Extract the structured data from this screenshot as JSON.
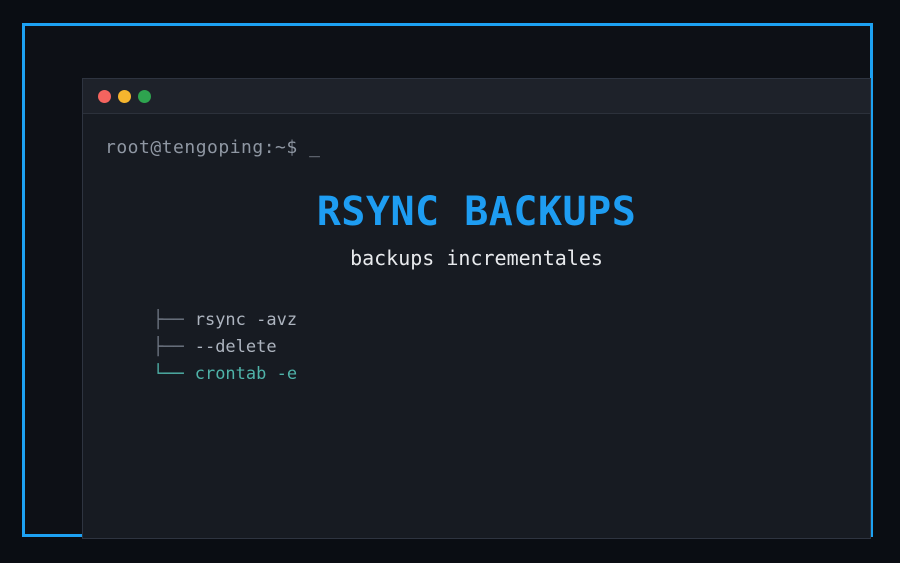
{
  "colors": {
    "page_bg": "#0a0d13",
    "frame_bg": "#0d1016",
    "accent": "#1da1f2",
    "terminal_bg": "#171b22",
    "terminal_border": "#2e3440",
    "header_bg": "#1e222a",
    "divider": "#2c313b",
    "light_red": "#f4645f",
    "light_yellow": "#f5b52e",
    "light_green": "#2ea44f",
    "prompt": "#8f97a3",
    "title": "#1e9df2",
    "subtitle": "#e8eaed",
    "tree_connector": "#6e7683",
    "item": "#adb4bf",
    "highlight": "#4fb3a9"
  },
  "terminal": {
    "traffic_lights": [
      {
        "name": "close",
        "color": "#f4645f"
      },
      {
        "name": "minimize",
        "color": "#f5b52e"
      },
      {
        "name": "maximize",
        "color": "#2ea44f"
      }
    ],
    "prompt": "root@tengoping:~$ _",
    "title": "RSYNC BACKUPS",
    "subtitle": "backups incrementales",
    "tree": {
      "items": [
        {
          "connector": "├──",
          "label": "rsync -avz",
          "highlight": false
        },
        {
          "connector": "├──",
          "label": "--delete",
          "highlight": false
        },
        {
          "connector": "└──",
          "label": "crontab -e",
          "highlight": true
        }
      ]
    }
  }
}
